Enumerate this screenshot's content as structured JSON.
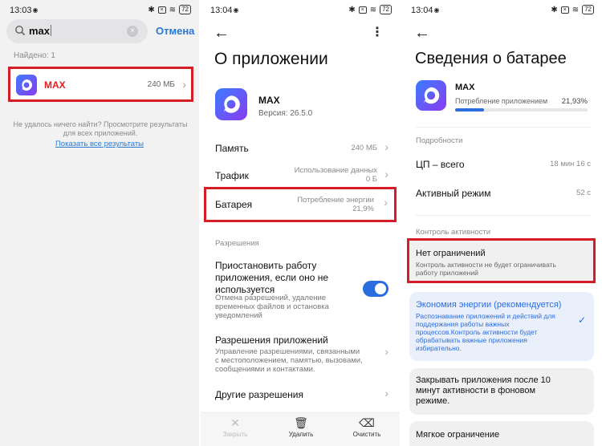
{
  "status": {
    "time1": "13:03",
    "time2": "13:04",
    "time3": "13:04",
    "battery": "72"
  },
  "panel1": {
    "search_value": "max",
    "cancel_label": "Отмена",
    "found_label": "Найдено: 1",
    "result": {
      "name": "MAX",
      "size": "240 МБ"
    },
    "no_result_text": "Не удалось ничего найти? Просмотрите результаты для всех приложений.",
    "show_all_label": "Показать все результаты"
  },
  "panel2": {
    "title": "О приложении",
    "app_name": "MAX",
    "app_version": "Версия: 26.5.0",
    "rows": [
      {
        "label": "Память",
        "value": "240 МБ"
      },
      {
        "label": "Трафик",
        "value_line1": "Использование данных",
        "value_line2": "0 Б"
      },
      {
        "label": "Батарея",
        "value_line1": "Потребление энергии",
        "value_line2": "21,9%"
      }
    ],
    "permissions_header": "Разрешения",
    "pause": {
      "title_l1": "Приостановить работу",
      "title_l2": "приложения, если оно не",
      "title_l3": "используется",
      "desc_l1": "Отмена разрешений, удаление",
      "desc_l2": "временных файлов и остановка",
      "desc_l3": "уведомлений",
      "enabled": true
    },
    "app_permissions": {
      "title": "Разрешения приложений",
      "desc_l1": "Управление разрешениями, связанными",
      "desc_l2": "с местоположением, памятью, вызовами,",
      "desc_l3": "сообщениями и контактами."
    },
    "other_permissions": "Другие разрешения",
    "bottom": {
      "close": "Закрыть",
      "delete": "Удалить",
      "clear": "Очистить"
    }
  },
  "panel3": {
    "title": "Сведения о батарее",
    "app_name": "MAX",
    "usage_label": "Потребление приложением",
    "usage_pct": "21,93%",
    "usage_fraction": 0.2193,
    "details_header": "Подробности",
    "cpu_label": "ЦП – всего",
    "cpu_value": "18 мин 16 с",
    "active_label": "Активный режим",
    "active_value": "52 с",
    "control_header": "Контроль активности",
    "no_limits": {
      "title": "Нет ограничений",
      "desc_l1": "Контроль активности не будет ограничивать",
      "desc_l2": "работу приложений"
    },
    "energy_saving": {
      "title": "Экономия энергии (рекомендуется)",
      "desc_l1": "Распознавание приложений и действий для",
      "desc_l2": "поддержания работы важных",
      "desc_l3": "процессов.Контроль активности будет",
      "desc_l4": "обрабатывать важные приложения",
      "desc_l5": "избирательно."
    },
    "close_after": {
      "l1": "Закрывать приложения после 10",
      "l2": "минут активности в фоновом",
      "l3": "режиме."
    },
    "soft_limit": "Мягкое ограничение"
  }
}
